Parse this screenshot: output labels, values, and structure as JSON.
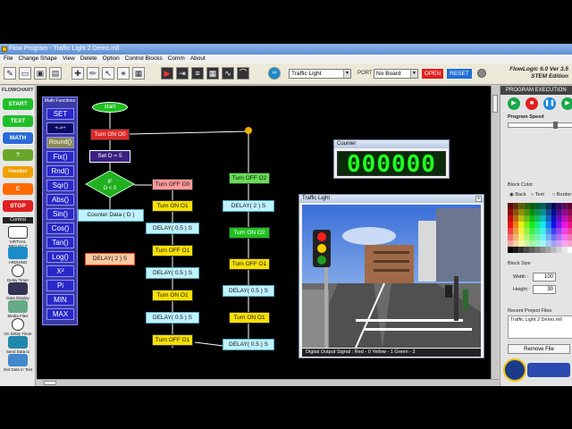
{
  "window": {
    "title": "Flow Program - Traffic Light 2 Demo.mll"
  },
  "menu": [
    "File",
    "Change Shape",
    "View",
    "Delete",
    "Option",
    "Control Blocks",
    "Comm",
    "About"
  ],
  "toolbar": {
    "program_value": "Traffic Light",
    "port_label": "PORT",
    "port_value": "No Board",
    "open_label": "OPEN",
    "reset_label": "RESET",
    "brand_line1": "FlowLogic 6.0 Ver 3.5",
    "brand_line2": "STEM Edition"
  },
  "left_panel": {
    "heading": "FLOWCHART",
    "buttons": [
      {
        "label": "START",
        "color": "#1fbf2a"
      },
      {
        "label": "TEXT",
        "color": "#1fbf2a"
      },
      {
        "label": "MATH",
        "color": "#2a6ad8"
      },
      {
        "label": "?",
        "color": "#6aa628"
      },
      {
        "label": "Function",
        "color": "#f0a000"
      },
      {
        "label": "C",
        "color": "#ff6a00"
      },
      {
        "label": "STOP",
        "color": "#e02020"
      }
    ],
    "control_heading": "Control",
    "items": [
      {
        "label": "VIRTUAL PROJECT"
      },
      {
        "label": "ARDUINO"
      },
      {
        "label": "Delay Timer"
      },
      {
        "label": "Data Display"
      },
      {
        "label": "Media Files"
      },
      {
        "label": "On Delay Timer"
      },
      {
        "label": "Send Data to Cloud"
      },
      {
        "label": "Get Data in Text"
      }
    ]
  },
  "math_panel": {
    "heading": "Math Functions",
    "buttons": [
      "SET",
      "+-×÷",
      "Round()",
      "Fix()",
      "Rnd()",
      "Sqr()",
      "Abs()",
      "Sin()",
      "Cos()",
      "Tan()",
      "Log()",
      "X²",
      "Pi",
      "MIN",
      "MAX"
    ]
  },
  "flowchart": {
    "start": "start",
    "turn_on_o0": "Turn ON O0",
    "set_d": "Set D = 5",
    "if_label": "IF",
    "if_cond": "D < 0",
    "counter_data": "Counter Data ( D )",
    "delay_2s_left": "DELAY( 2 ) S",
    "col1": [
      "Turn OFF O0",
      "Turn ON O1",
      "DELAY( 0.5 ) S",
      "Turn OFF O1",
      "DELAY( 0.5 ) S",
      "Turn ON O1",
      "DELAY( 0.5 ) S",
      "Turn OFF O1"
    ],
    "col2": [
      "Turn OFF O2",
      "DELAY( 2 ) S",
      "Turn ON O2",
      "Turn OFF O1",
      "DELAY( 0.5 ) S",
      "Turn ON O1",
      "DELAY( 0.5 ) S"
    ]
  },
  "counter": {
    "title": "Counter",
    "value": "000000"
  },
  "traffic_window": {
    "title": "Traffic Light",
    "status": "Digital Output Signal :   Red - 0    Yellow - 1    Green - 2"
  },
  "right_panel": {
    "heading": "PROGRAM EXECUTION",
    "speed_label": "Program Speed",
    "block_color_label": "Block Color",
    "radio_back": "Back",
    "radio_text": "Text",
    "radio_border": "Border",
    "block_size_label": "Block Size",
    "width_label": "Width :",
    "width_value": "100",
    "height_label": "Height :",
    "height_value": "30",
    "recent_label": "Recent Project Files",
    "recent_file": "Traffic Light 2 Demo.mll",
    "remove_label": "Remove File"
  }
}
